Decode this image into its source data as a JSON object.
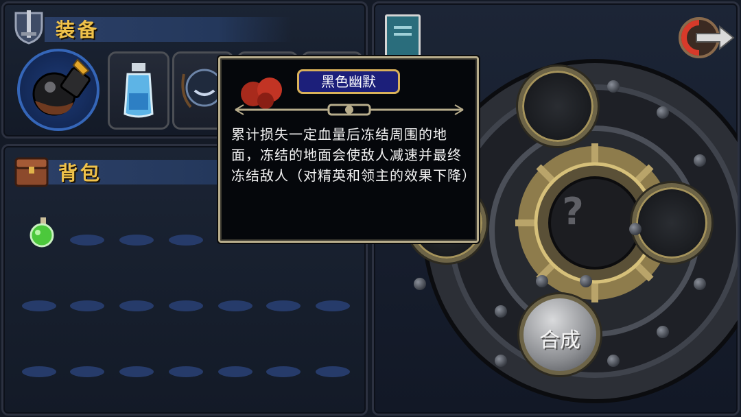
{
  "equipment": {
    "title": "装备"
  },
  "backpack": {
    "title": "背包"
  },
  "tooltip": {
    "item_name": "黑色幽默",
    "description": "累计损失一定血量后冻结周围的地面，冻结的地面会使敌人减速并最终冻结敌人（对精英和领主的效果下降）"
  },
  "crafting": {
    "combine_label": "合成",
    "mystery_symbol": "?"
  },
  "icons": {
    "equip_header": "sword-shield-icon",
    "bag_header": "backpack-chest-icon",
    "journal": "book-icon",
    "exit": "exit-arrow-icon"
  },
  "colors": {
    "title_gold": "#f0c24a",
    "bag_slot": "#263b6a",
    "item_title_bg": "#1c1f7a"
  }
}
